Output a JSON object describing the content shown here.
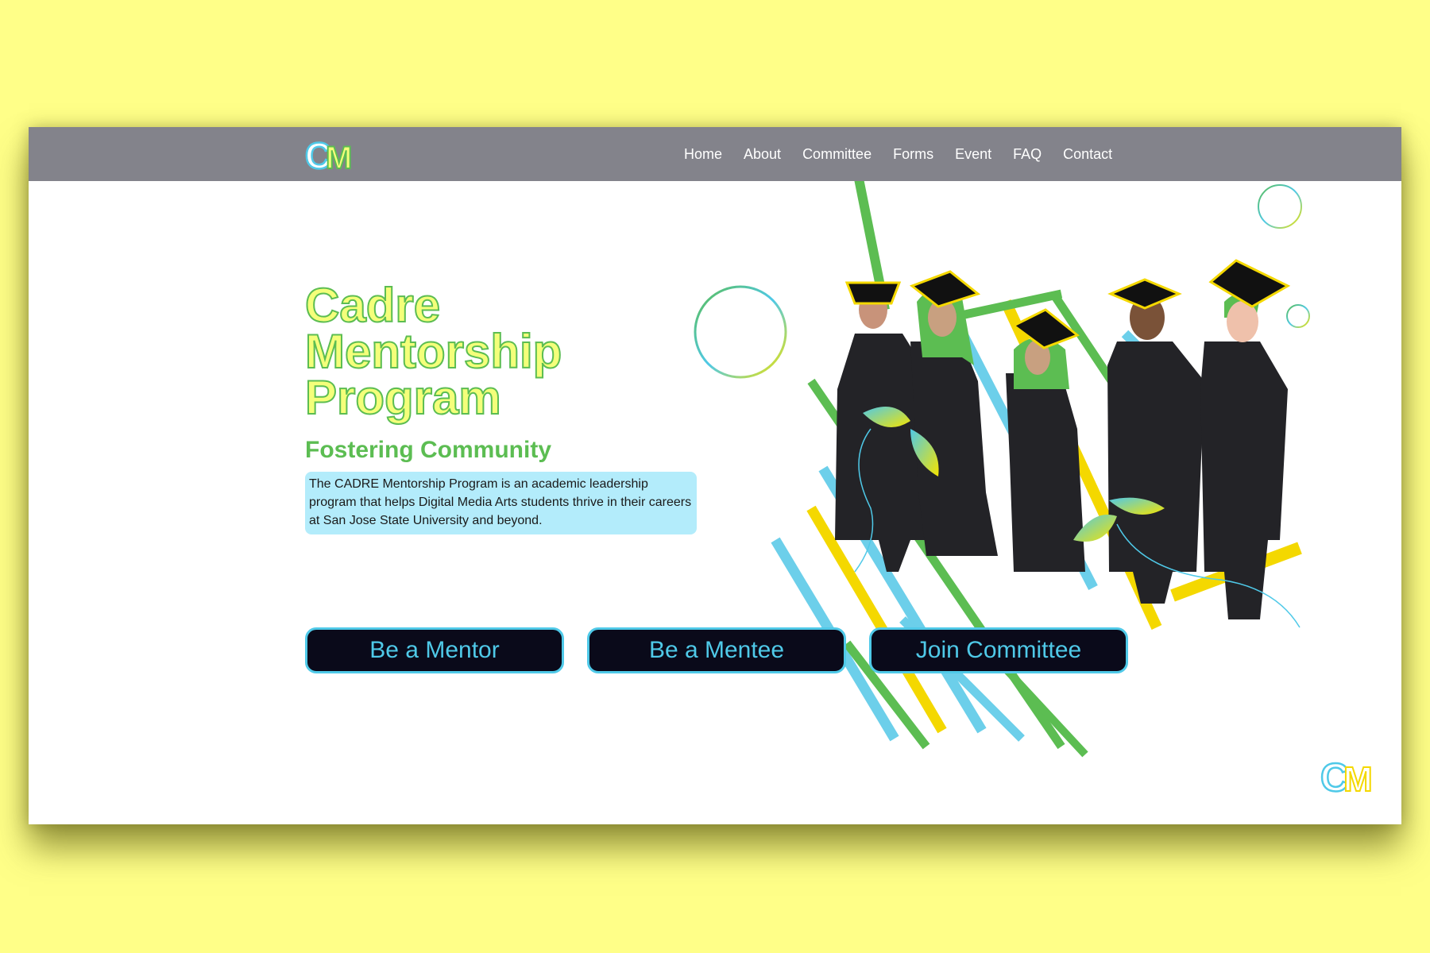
{
  "brand": {
    "logo_text": "CM",
    "colors": {
      "yellow": "#f4ff7a",
      "green": "#5cbd52",
      "blue": "#4fc9e8",
      "nav_bg": "#83838b"
    }
  },
  "nav": {
    "items": [
      {
        "label": "Home"
      },
      {
        "label": "About"
      },
      {
        "label": "Committee"
      },
      {
        "label": "Forms"
      },
      {
        "label": "Event"
      },
      {
        "label": "FAQ"
      },
      {
        "label": "Contact"
      }
    ]
  },
  "hero": {
    "title_line1": "Cadre",
    "title_line2": "Mentorship",
    "title_line3": "Program",
    "subtitle": "Fostering Community",
    "description": "The CADRE Mentorship Program is an academic leadership program that helps Digital Media Arts students thrive in their careers at San Jose State University and beyond."
  },
  "buttons": {
    "mentor": "Be a Mentor",
    "mentee": "Be a Mentee",
    "committee": "Join Committee"
  },
  "illustration": {
    "subject": "graduates-in-caps-and-gowns",
    "icons": [
      "circle-decoration",
      "stripe-decoration",
      "leaf-decoration"
    ]
  }
}
